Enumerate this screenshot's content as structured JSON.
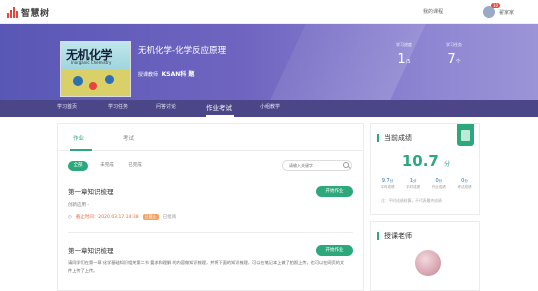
{
  "app": {
    "name": "智慧树"
  },
  "topbar": {
    "my_courses": "我的课程",
    "username": "翟家家",
    "badge": "10"
  },
  "course": {
    "cover_title": "无机化学",
    "cover_subtitle": "Inorganic Chemistry",
    "title": "无机化学-化学反应原理",
    "teacher_label": "授课教师",
    "teacher_name": "KSAN科 题",
    "stats": [
      {
        "label": "学习进度",
        "value": "1",
        "unit": "/5"
      },
      {
        "label": "学习任务",
        "value": "7",
        "unit": "个"
      }
    ]
  },
  "course_tabs": [
    "学习首页",
    "学习任务",
    "问答讨论",
    "作业考试",
    "小组教学"
  ],
  "active_course_tab": "作业考试",
  "sub_tabs": [
    "作业",
    "考试"
  ],
  "filters": [
    "全部",
    "未完成",
    "已完成"
  ],
  "search": {
    "placeholder": "请输入关键字"
  },
  "homeworks": [
    {
      "title": "第一章知识梳理",
      "subtitle": "创新应用 -",
      "deadline": "截止时间：2020.03.17 14:38",
      "tag": "已截止",
      "status": "已批阅",
      "button": "开始作业"
    },
    {
      "title": "第一章知识梳理",
      "description": "请同学们在第一章 化学基础知识相关第二节 要求和理解 的内容做知识梳理，并将下面的知识梳理，可以在笔记本上做了拍照上传，也可以在网页的文件上传了上传。",
      "button": "开始作业"
    }
  ],
  "score_card": {
    "title": "当前成绩",
    "score": "10.7",
    "unit": "分",
    "metrics": [
      {
        "value": "9.7",
        "unit": "分",
        "label": "平时成绩"
      },
      {
        "value": "1",
        "unit": "分",
        "label": "平时成绩"
      },
      {
        "value": "0",
        "unit": "分",
        "label": "作业成绩"
      },
      {
        "value": "0",
        "unit": "分",
        "label": "考试成绩"
      }
    ],
    "note": "注：平时成绩核算，不代表最终成绩"
  },
  "teacher_card": {
    "title": "授课老师"
  },
  "colors": {
    "accent": "#2da87c",
    "banner": "#5957b5",
    "tabbar": "#4a4687"
  }
}
